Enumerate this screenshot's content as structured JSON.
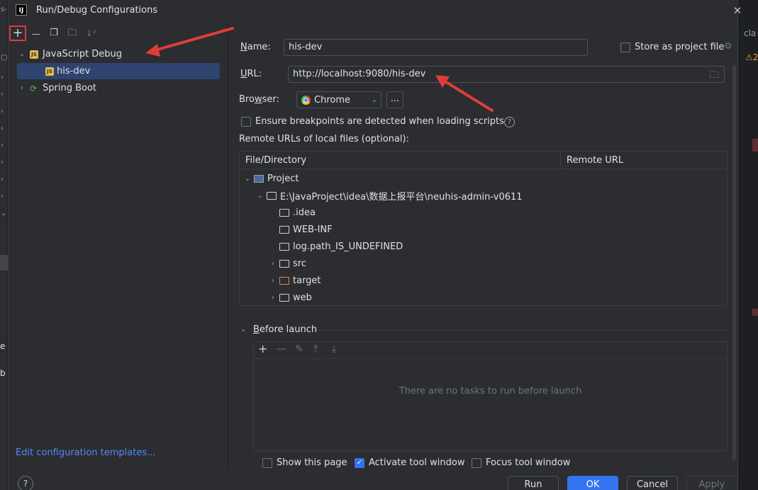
{
  "dialog": {
    "title": "Run/Debug Configurations",
    "close_icon": "close-icon"
  },
  "toolbar": {
    "add": "+",
    "remove": "—",
    "copy": "❐",
    "new_folder": "🗀",
    "sort": "↓²"
  },
  "tree": {
    "groups": [
      {
        "label": "JavaScript Debug",
        "expanded": true,
        "icon": "js-icon"
      },
      {
        "label": "Spring Boot",
        "expanded": false,
        "icon": "spring-boot-icon"
      }
    ],
    "selected_item": "his-dev"
  },
  "edit_templates": "Edit configuration templates...",
  "form": {
    "name_label_u": "N",
    "name_label_rest": "ame:",
    "name_value": "his-dev",
    "store_label": "Store as project file",
    "url_label_u": "U",
    "url_label_rest": "RL:",
    "url_value": "http://localhost:9080/his-dev",
    "browser_label_pre": "Bro",
    "browser_label_u": "w",
    "browser_label_rest": "ser:",
    "browser_value": "Chrome",
    "browse_dots": "...",
    "ensure_label": "Ensure breakpoints are detected when loading scripts",
    "remote_urls_label": "Remote URLs of local files (optional):"
  },
  "table": {
    "columns": [
      "File/Directory",
      "Remote URL"
    ],
    "rows": [
      {
        "label": "Project",
        "indent": 0,
        "arrow": "⌄",
        "icon": "project-icon"
      },
      {
        "label": "E:\\JavaProject\\idea\\数据上报平台\\neuhis-admin-v0611",
        "indent": 1,
        "arrow": "⌄",
        "icon": "folder-icon"
      },
      {
        "label": ".idea",
        "indent": 2,
        "arrow": "",
        "icon": "folder-icon"
      },
      {
        "label": "WEB-INF",
        "indent": 2,
        "arrow": "",
        "icon": "folder-icon"
      },
      {
        "label": "log.path_IS_UNDEFINED",
        "indent": 2,
        "arrow": "",
        "icon": "folder-icon"
      },
      {
        "label": "src",
        "indent": 2,
        "arrow": "›",
        "icon": "folder-icon"
      },
      {
        "label": "target",
        "indent": 2,
        "arrow": "›",
        "icon": "folder-orange-icon"
      },
      {
        "label": "web",
        "indent": 2,
        "arrow": "›",
        "icon": "folder-icon"
      }
    ]
  },
  "before_launch": {
    "header_u": "B",
    "header_rest": "efore launch",
    "empty_text": "There are no tasks to run before launch"
  },
  "options": {
    "show_page": "Show this page",
    "show_page_checked": false,
    "activate": "Activate tool window",
    "activate_checked": true,
    "focus": "Focus tool window",
    "focus_checked": false
  },
  "buttons": {
    "help": "?",
    "run": "Run",
    "ok": "OK",
    "cancel": "Cancel",
    "apply": "Apply"
  },
  "colors": {
    "accent": "#3574f0",
    "annotation": "#e03c3c",
    "selection": "#2e436e",
    "link": "#548af7"
  }
}
